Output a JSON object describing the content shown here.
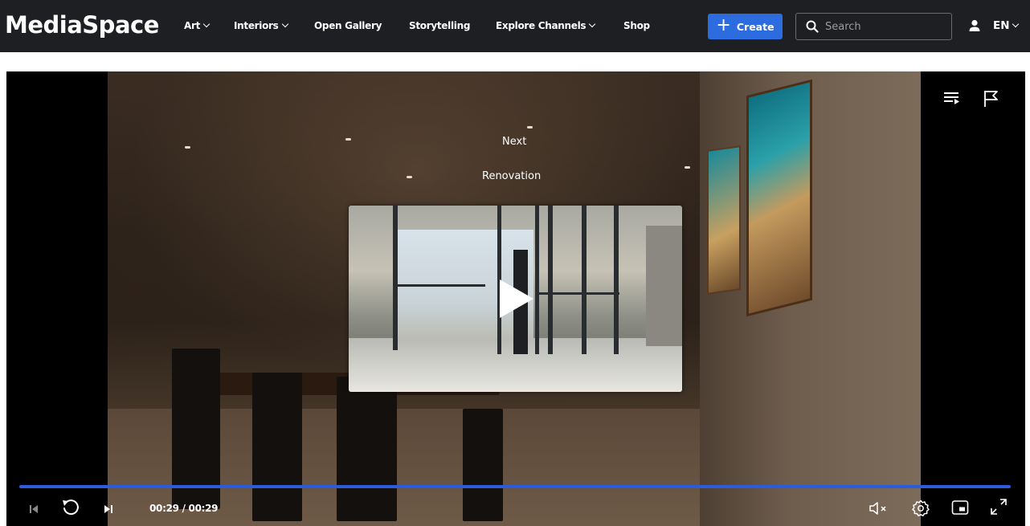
{
  "app": {
    "logo": "MediaSpace"
  },
  "nav": {
    "items": [
      {
        "label": "Art",
        "has_dropdown": true
      },
      {
        "label": "Interiors",
        "has_dropdown": true
      },
      {
        "label": "Open Gallery",
        "has_dropdown": false
      },
      {
        "label": "Storytelling",
        "has_dropdown": false
      },
      {
        "label": "Explore Channels",
        "has_dropdown": true
      },
      {
        "label": "Shop",
        "has_dropdown": false
      }
    ],
    "create_label": "Create",
    "search_placeholder": "Search",
    "language": "EN"
  },
  "player": {
    "next_label": "Next",
    "next_title": "Renovation",
    "current_time": "00:29",
    "duration": "00:29",
    "time_display": "00:29 / 00:29",
    "progress": 1.0,
    "muted": true,
    "icons": {
      "playlist": "playlist-icon",
      "report": "flag-icon",
      "prev": "skip-previous-icon",
      "replay": "replay-icon",
      "next": "skip-next-icon",
      "volume": "volume-muted-icon",
      "settings": "settings-icon",
      "pip": "picture-in-picture-icon",
      "fullscreen": "fullscreen-icon"
    }
  },
  "colors": {
    "navbar_bg": "#1e1f22",
    "accent": "#2d6cdf",
    "progress": "#2d5bd9"
  }
}
